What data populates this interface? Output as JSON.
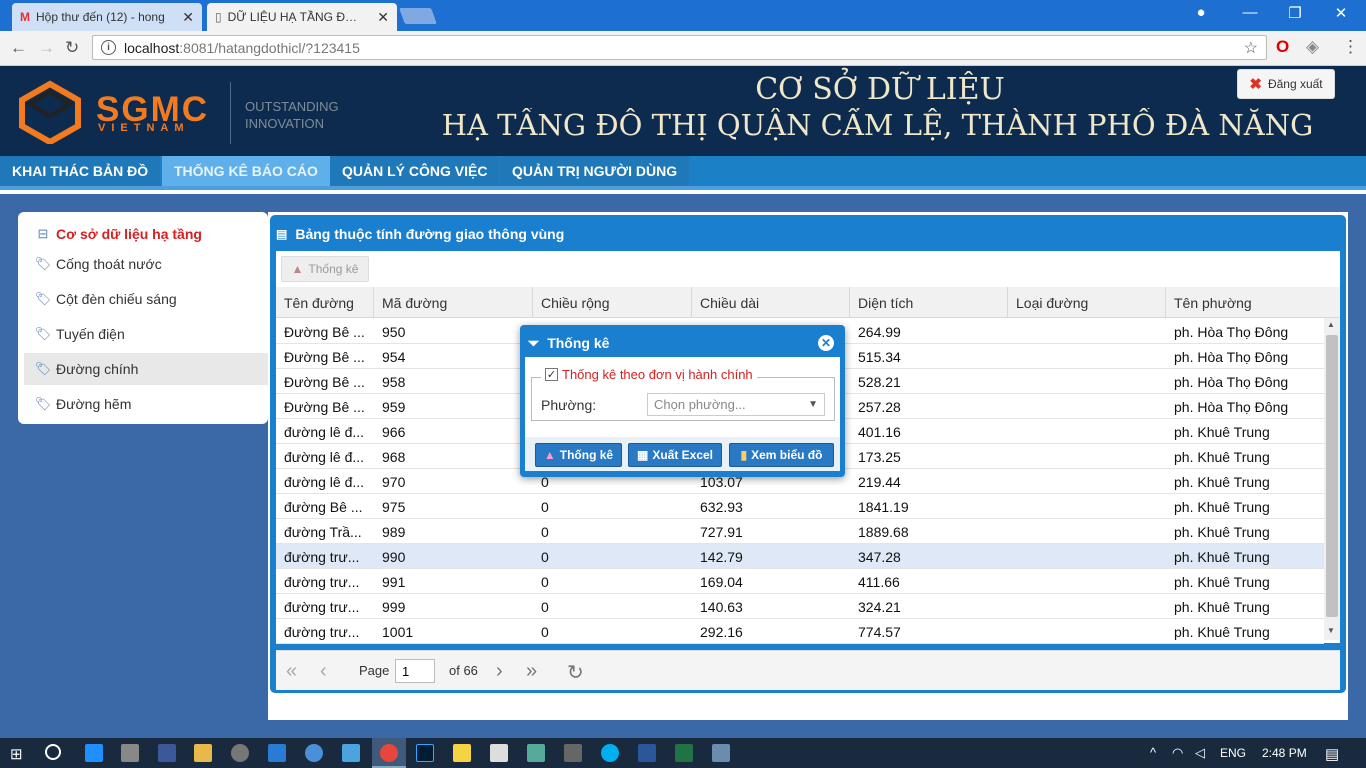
{
  "browser": {
    "tabs": [
      {
        "title": "Hộp thư đến (12) - hong",
        "icon": "gmail-icon"
      },
      {
        "title": "DỮ LIỆU HẠ TẦNG ĐÔ TH",
        "icon": "page-icon"
      }
    ],
    "url_host": "localhost",
    "url_path": ":8081/hatangdothicl/?123415"
  },
  "banner": {
    "logo_main": "SGMC",
    "logo_sub": "VIETNAM",
    "tagline_1": "OUTSTANDING",
    "tagline_2": "INNOVATION",
    "title_1": "CƠ SỞ DỮ LIỆU",
    "title_2": "HẠ TẦNG ĐÔ THỊ QUẬN CẨM LỆ, THÀNH PHỐ ĐÀ NẴNG",
    "logout": "Đăng xuất"
  },
  "menu": {
    "items": [
      "KHAI THÁC BẢN ĐỒ",
      "THỐNG KÊ BÁO CÁO",
      "QUẢN LÝ CÔNG VIỆC",
      "QUẢN TRỊ NGƯỜI DÙNG"
    ]
  },
  "sidebar": {
    "root": "Cơ sở dữ liệu hạ tầng",
    "items": [
      "Cống thoát nước",
      "Cột đèn chiếu sáng",
      "Tuyến điện",
      "Đường chính",
      "Đường hẽm"
    ]
  },
  "panel": {
    "title": "Bảng thuộc tính đường giao thông vùng",
    "toolbar_button": "Thống kê"
  },
  "grid": {
    "columns": [
      "Tên đường",
      "Mã đường",
      "Chiều rộng",
      "Chiều dài",
      "Diện tích",
      "Loại đường",
      "Tên phường"
    ],
    "rows": [
      [
        "Đường Bê ...",
        "950",
        "",
        "",
        "264.99",
        "",
        "ph. Hòa Thọ Đông"
      ],
      [
        "Đường Bê ...",
        "954",
        "",
        "",
        "515.34",
        "",
        "ph. Hòa Thọ Đông"
      ],
      [
        "Đường Bê ...",
        "958",
        "",
        "",
        "528.21",
        "",
        "ph. Hòa Thọ Đông"
      ],
      [
        "Đường Bê ...",
        "959",
        "",
        "",
        "257.28",
        "",
        "ph. Hòa Thọ Đông"
      ],
      [
        "đường lê đ...",
        "966",
        "",
        "",
        "401.16",
        "",
        "ph. Khuê Trung"
      ],
      [
        "đường lê đ...",
        "968",
        "",
        "",
        "173.25",
        "",
        "ph. Khuê Trung"
      ],
      [
        "đường lê đ...",
        "970",
        "0",
        "103.07",
        "219.44",
        "",
        "ph. Khuê Trung"
      ],
      [
        "đường Bê ...",
        "975",
        "0",
        "632.93",
        "1841.19",
        "",
        "ph. Khuê Trung"
      ],
      [
        "đường Trầ...",
        "989",
        "0",
        "727.91",
        "1889.68",
        "",
        "ph. Khuê Trung"
      ],
      [
        "đường trư...",
        "990",
        "0",
        "142.79",
        "347.28",
        "",
        "ph. Khuê Trung"
      ],
      [
        "đường trư...",
        "991",
        "0",
        "169.04",
        "411.66",
        "",
        "ph. Khuê Trung"
      ],
      [
        "đường trư...",
        "999",
        "0",
        "140.63",
        "324.21",
        "",
        "ph. Khuê Trung"
      ],
      [
        "đường trư...",
        "1001",
        "0",
        "292.16",
        "774.57",
        "",
        "ph. Khuê Trung"
      ]
    ],
    "selected_row": 9
  },
  "pager": {
    "label": "Page",
    "current": "1",
    "of": "of 66"
  },
  "dialog": {
    "title": "Thống kê",
    "checkbox_label": "Thống kê theo đơn vị hành chính",
    "checked": true,
    "ward_label": "Phường:",
    "ward_placeholder": "Chọn phường...",
    "buttons": [
      "Thống kê",
      "Xuất Excel",
      "Xem biểu đồ"
    ]
  },
  "taskbar": {
    "lang": "ENG",
    "time": "2:48 PM"
  },
  "colors": {
    "accent": "#1b7fd0",
    "banner": "#0d2b4e",
    "logo": "#f47a20",
    "active_menu": "#5fb0ea",
    "red_text": "#d42121"
  }
}
